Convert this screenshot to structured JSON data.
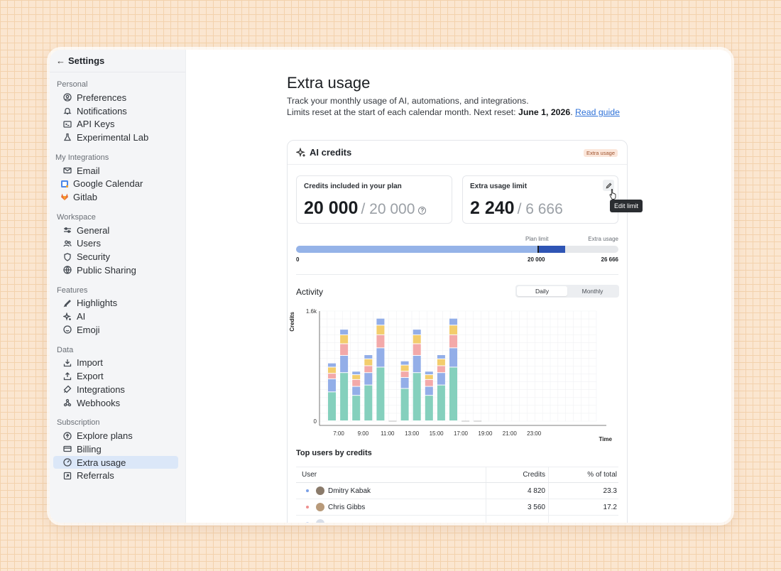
{
  "sidebar": {
    "title": "Settings",
    "sections": {
      "personal": "Personal",
      "integrations": "My Integrations",
      "workspace": "Workspace",
      "features": "Features",
      "data": "Data",
      "subscription": "Subscription"
    },
    "items": {
      "preferences": "Preferences",
      "notifications": "Notifications",
      "api_keys": "API Keys",
      "experimental": "Experimental Lab",
      "email": "Email",
      "google_calendar": "Google Calendar",
      "gitlab": "Gitlab",
      "general": "General",
      "users": "Users",
      "security": "Security",
      "public_sharing": "Public Sharing",
      "highlights": "Highlights",
      "ai": "AI",
      "emoji": "Emoji",
      "import": "Import",
      "export": "Export",
      "integrations": "Integrations",
      "webhooks": "Webhooks",
      "explore_plans": "Explore plans",
      "billing": "Billing",
      "extra_usage": "Extra usage",
      "referrals": "Referrals"
    }
  },
  "page": {
    "title": "Extra usage",
    "desc_line1": "Track your monthly usage of AI, automations, and integrations.",
    "desc_line2_prefix": "Limits reset at the start of each calendar month. Next reset: ",
    "reset_date": "June 1, 2026",
    "desc_line2_suffix": ". ",
    "read_guide": "Read guide"
  },
  "card": {
    "title": "AI credits",
    "badge": "Extra usage",
    "included": {
      "label": "Credits included in your plan",
      "value": "20 000",
      "of": "/ 20 000",
      "help": "?"
    },
    "limit": {
      "label": "Extra usage limit",
      "value": "2 240",
      "of": "/ 6 666"
    },
    "tooltip": "Edit limit",
    "progress": {
      "plan_limit_label": "Plan limit",
      "extra_label": "Extra usage",
      "start": "0",
      "plan": "20 000",
      "max": "26 666",
      "used": 22240,
      "plan_value": 20000,
      "max_value": 26666
    },
    "activity": {
      "title": "Activity",
      "tab_daily": "Daily",
      "tab_monthly": "Monthly"
    },
    "top_users": {
      "title": "Top users by credits",
      "col_user": "User",
      "col_credits": "Credits",
      "col_pct": "% of total",
      "rows": [
        {
          "name": "Dmitry Kabak",
          "credits": "4 820",
          "pct": "23.3",
          "dot": "#7aa0e6",
          "avatar": "#8a7a6a"
        },
        {
          "name": "Chris Gibbs",
          "credits": "3 560",
          "pct": "17.2",
          "dot": "#ef8f8f",
          "avatar": "#b89a7a"
        }
      ]
    }
  },
  "chart_data": {
    "type": "bar",
    "stacked": true,
    "ylabel": "Credits",
    "xlabel": "Time",
    "ylim": [
      0,
      1600
    ],
    "y_ticks": [
      "0",
      "1.6k"
    ],
    "x_ticks": [
      "7:00",
      "9:00",
      "11:00",
      "13:00",
      "15:00",
      "17:00",
      "19:00",
      "21:00",
      "23:00"
    ],
    "colors": [
      "#85d0bd",
      "#93aee8",
      "#f3a9a9",
      "#f3cd6c",
      "#93aee8"
    ],
    "series_values": [
      [
        420,
        190,
        80,
        90,
        60
      ],
      [
        700,
        250,
        170,
        130,
        80
      ],
      [
        370,
        130,
        100,
        70,
        50
      ],
      [
        520,
        180,
        100,
        100,
        60
      ],
      [
        780,
        280,
        190,
        140,
        100
      ],
      [
        0,
        0,
        0,
        0,
        0
      ],
      [
        470,
        160,
        90,
        90,
        60
      ],
      [
        700,
        250,
        170,
        130,
        80
      ],
      [
        370,
        130,
        100,
        70,
        50
      ],
      [
        520,
        180,
        100,
        100,
        60
      ],
      [
        780,
        280,
        190,
        140,
        100
      ],
      [
        0,
        0,
        0,
        0,
        0
      ],
      [
        0,
        0,
        0,
        0,
        0
      ]
    ]
  }
}
